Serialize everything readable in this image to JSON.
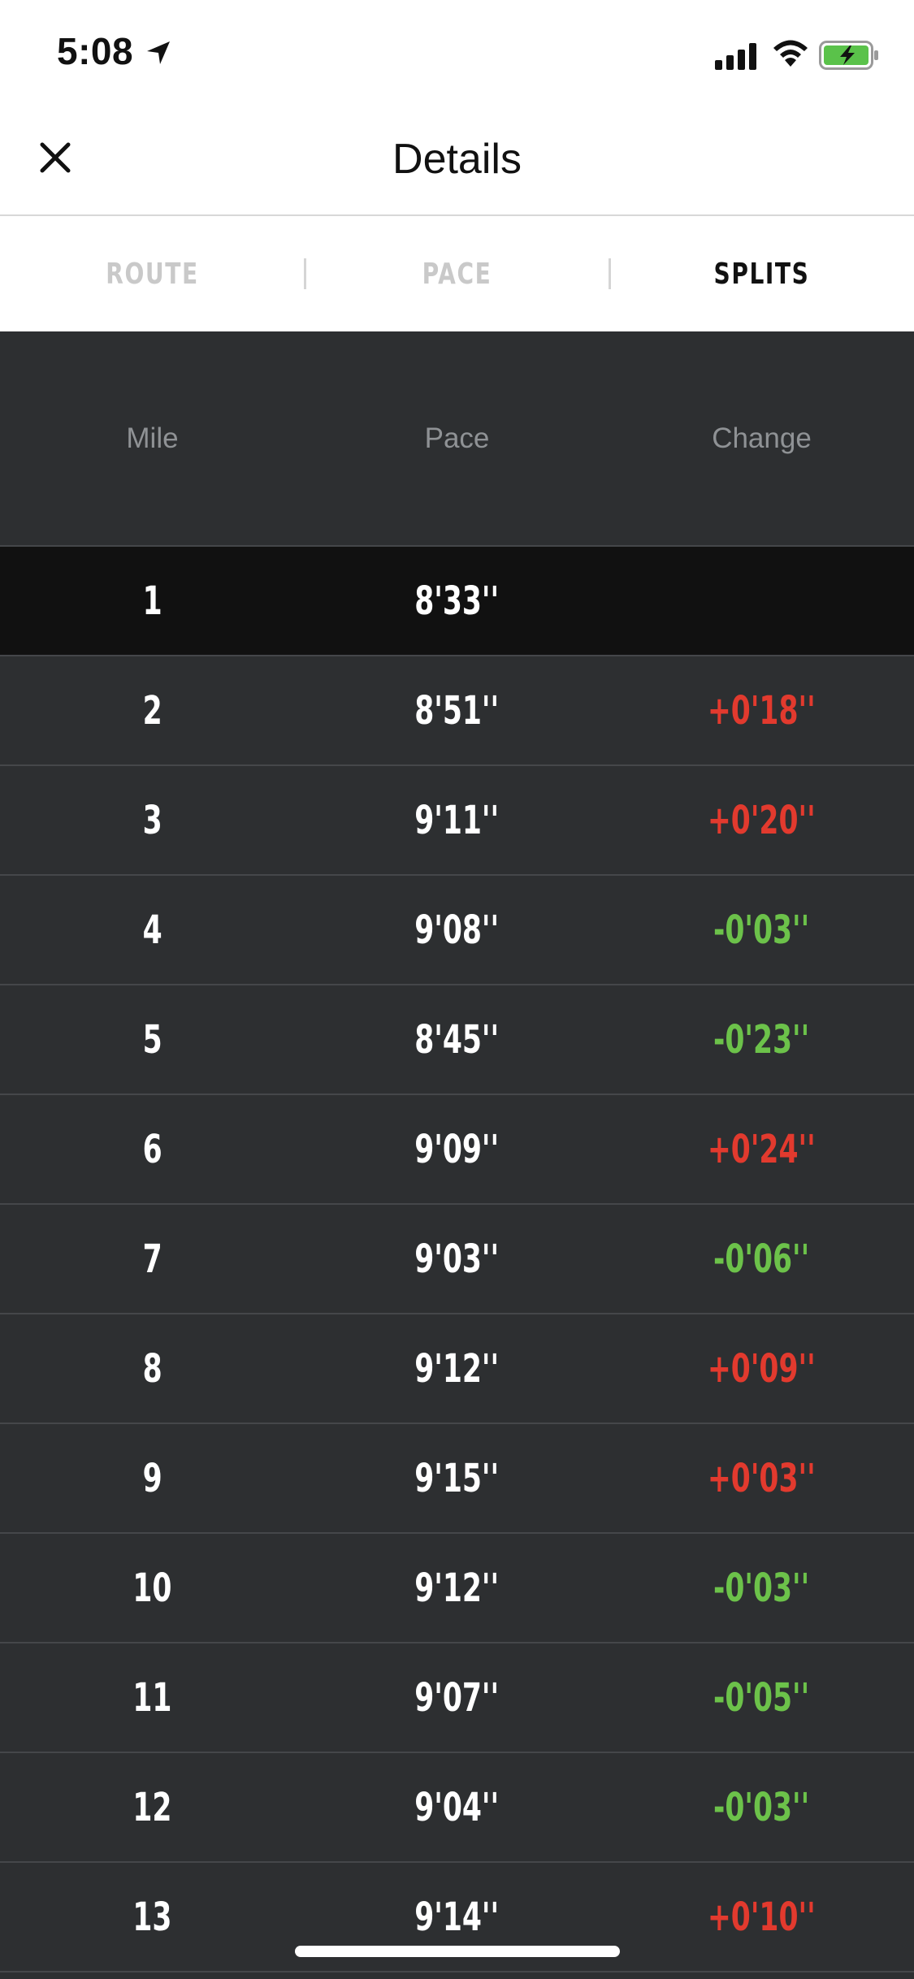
{
  "status_bar": {
    "time": "5:08"
  },
  "nav": {
    "title": "Details"
  },
  "tabs": [
    {
      "label": "ROUTE",
      "active": false
    },
    {
      "label": "PACE",
      "active": false
    },
    {
      "label": "SPLITS",
      "active": true
    }
  ],
  "table": {
    "headers": [
      "Mile",
      "Pace",
      "Change"
    ],
    "rows": [
      {
        "mile": "1",
        "pace": "8'33''",
        "change": "",
        "trend": "none",
        "highlight": true
      },
      {
        "mile": "2",
        "pace": "8'51''",
        "change": "+0'18''",
        "trend": "slower"
      },
      {
        "mile": "3",
        "pace": "9'11''",
        "change": "+0'20''",
        "trend": "slower"
      },
      {
        "mile": "4",
        "pace": "9'08''",
        "change": "-0'03''",
        "trend": "faster"
      },
      {
        "mile": "5",
        "pace": "8'45''",
        "change": "-0'23''",
        "trend": "faster"
      },
      {
        "mile": "6",
        "pace": "9'09''",
        "change": "+0'24''",
        "trend": "slower"
      },
      {
        "mile": "7",
        "pace": "9'03''",
        "change": "-0'06''",
        "trend": "faster"
      },
      {
        "mile": "8",
        "pace": "9'12''",
        "change": "+0'09''",
        "trend": "slower"
      },
      {
        "mile": "9",
        "pace": "9'15''",
        "change": "+0'03''",
        "trend": "slower"
      },
      {
        "mile": "10",
        "pace": "9'12''",
        "change": "-0'03''",
        "trend": "faster"
      },
      {
        "mile": "11",
        "pace": "9'07''",
        "change": "-0'05''",
        "trend": "faster"
      },
      {
        "mile": "12",
        "pace": "9'04''",
        "change": "-0'03''",
        "trend": "faster"
      },
      {
        "mile": "13",
        "pace": "9'14''",
        "change": "+0'10''",
        "trend": "slower"
      }
    ]
  },
  "colors": {
    "slower": "#e23a2e",
    "faster": "#6cc24a",
    "background": "#2d2f31",
    "highlight_row": "#111111",
    "battery_fill": "#5ac24a"
  },
  "icons": {
    "close": "close-icon",
    "location": "location-arrow-icon",
    "signal": "cellular-signal-icon",
    "wifi": "wifi-icon",
    "battery": "battery-charging-icon"
  }
}
